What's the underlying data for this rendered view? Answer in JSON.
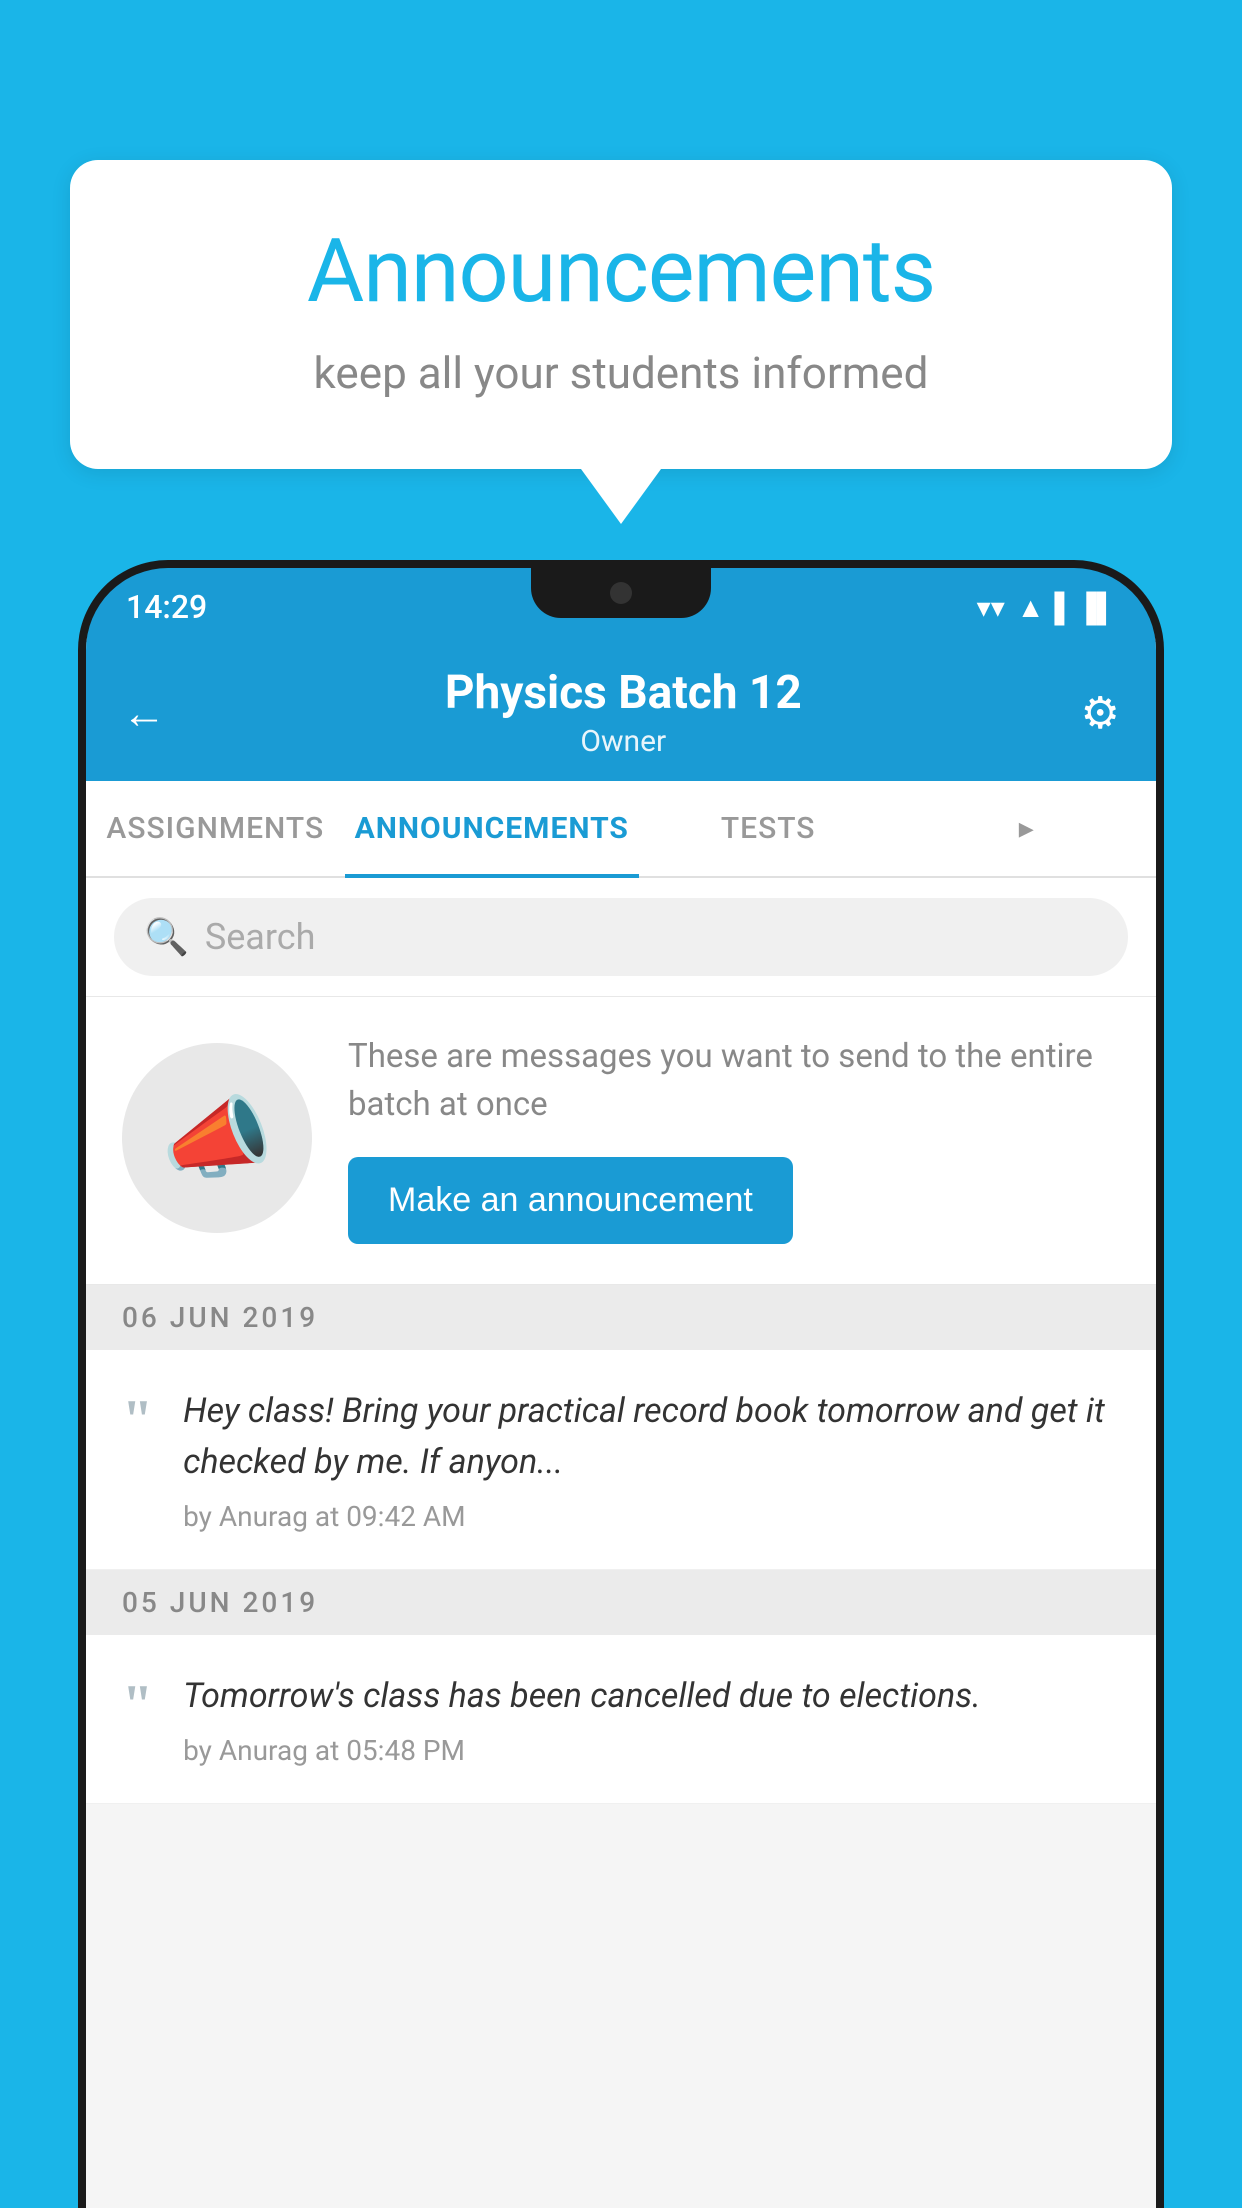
{
  "background_color": "#1ab5e8",
  "bubble": {
    "title": "Announcements",
    "subtitle": "keep all your students informed"
  },
  "status_bar": {
    "time": "14:29",
    "wifi": "▼",
    "signal": "▲",
    "battery": "▐"
  },
  "header": {
    "title": "Physics Batch 12",
    "subtitle": "Owner",
    "back_label": "←",
    "gear_label": "⚙"
  },
  "tabs": [
    {
      "label": "ASSIGNMENTS",
      "active": false
    },
    {
      "label": "ANNOUNCEMENTS",
      "active": true
    },
    {
      "label": "TESTS",
      "active": false
    },
    {
      "label": "▸",
      "active": false
    }
  ],
  "search": {
    "placeholder": "Search"
  },
  "promo": {
    "description": "These are messages you want to send to the entire batch at once",
    "button_label": "Make an announcement"
  },
  "announcements": [
    {
      "date": "06  JUN  2019",
      "items": [
        {
          "text": "Hey class! Bring your practical record book tomorrow and get it checked by me. If anyon...",
          "meta": "by Anurag at 09:42 AM"
        }
      ]
    },
    {
      "date": "05  JUN  2019",
      "items": [
        {
          "text": "Tomorrow's class has been cancelled due to elections.",
          "meta": "by Anurag at 05:48 PM"
        }
      ]
    }
  ]
}
